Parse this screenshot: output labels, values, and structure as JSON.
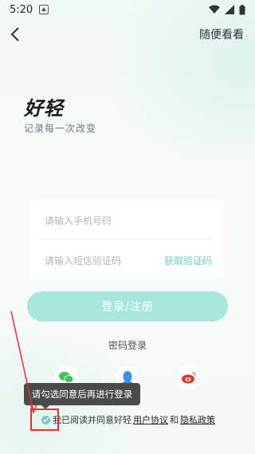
{
  "status_bar": {
    "time": "5:20"
  },
  "header": {
    "skip_label": "随便看看"
  },
  "brand": {
    "logo": "好轻",
    "slogan": "记录每一次改变"
  },
  "form": {
    "phone_placeholder": "请输入手机号码",
    "code_placeholder": "请输入短信验证码",
    "get_code_label": "获取验证码"
  },
  "login_button": "登录/注册",
  "password_login": "密码登录",
  "tooltip": "请勾选同意后再进行登录",
  "agreement": {
    "prefix": "我已阅读并同意好轻",
    "user_agreement": "用户协议",
    "and": "和",
    "privacy_policy": "隐私政策"
  },
  "social_icons": [
    "wechat-icon",
    "qq-icon",
    "weibo-icon"
  ],
  "colors": {
    "accent": "#69d2c3",
    "login_button": "#a9e7dd",
    "annotation": "#e03030"
  }
}
